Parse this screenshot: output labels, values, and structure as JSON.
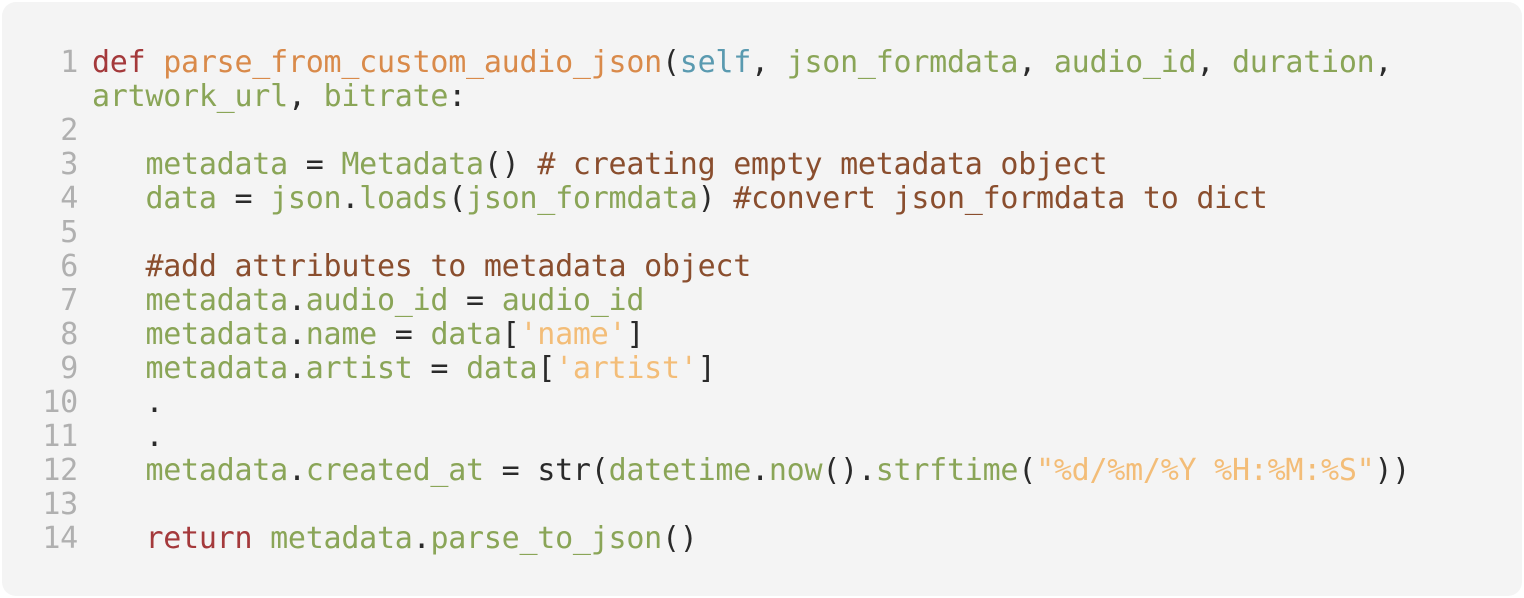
{
  "code": {
    "lines": [
      {
        "n": "1",
        "indent": "",
        "wrap": true,
        "tokens": [
          {
            "t": "def",
            "c": "kw"
          },
          {
            "t": " ",
            "c": "p"
          },
          {
            "t": "parse_from_custom_audio_json",
            "c": "fn"
          },
          {
            "t": "(",
            "c": "p"
          },
          {
            "t": "self",
            "c": "self"
          },
          {
            "t": ", ",
            "c": "p"
          },
          {
            "t": "json_formdata",
            "c": "var"
          },
          {
            "t": ", ",
            "c": "p"
          },
          {
            "t": "audio_id",
            "c": "var"
          },
          {
            "t": ", ",
            "c": "p"
          },
          {
            "t": "duration",
            "c": "var"
          },
          {
            "t": ",",
            "c": "p"
          }
        ]
      },
      {
        "n": "",
        "indent": "",
        "tokens": [
          {
            "t": "artwork_url",
            "c": "var"
          },
          {
            "t": ", ",
            "c": "p"
          },
          {
            "t": "bitrate",
            "c": "var"
          },
          {
            "t": ":",
            "c": "p"
          }
        ]
      },
      {
        "n": "2",
        "indent": "",
        "tokens": []
      },
      {
        "n": "3",
        "indent": "   ",
        "tokens": [
          {
            "t": "metadata",
            "c": "var"
          },
          {
            "t": " = ",
            "c": "p"
          },
          {
            "t": "Metadata",
            "c": "var"
          },
          {
            "t": "() ",
            "c": "p"
          },
          {
            "t": "# creating empty metadata object",
            "c": "com"
          }
        ]
      },
      {
        "n": "4",
        "indent": "   ",
        "tokens": [
          {
            "t": "data",
            "c": "var"
          },
          {
            "t": " = ",
            "c": "p"
          },
          {
            "t": "json",
            "c": "var"
          },
          {
            "t": ".",
            "c": "p"
          },
          {
            "t": "loads",
            "c": "var"
          },
          {
            "t": "(",
            "c": "p"
          },
          {
            "t": "json_formdata",
            "c": "var"
          },
          {
            "t": ") ",
            "c": "p"
          },
          {
            "t": "#convert json_formdata to dict",
            "c": "com"
          }
        ]
      },
      {
        "n": "5",
        "indent": "",
        "tokens": []
      },
      {
        "n": "6",
        "indent": "   ",
        "tokens": [
          {
            "t": "#add attributes to metadata object",
            "c": "com"
          }
        ]
      },
      {
        "n": "7",
        "indent": "   ",
        "tokens": [
          {
            "t": "metadata",
            "c": "var"
          },
          {
            "t": ".",
            "c": "p"
          },
          {
            "t": "audio_id",
            "c": "var"
          },
          {
            "t": " = ",
            "c": "p"
          },
          {
            "t": "audio_id",
            "c": "var"
          }
        ]
      },
      {
        "n": "8",
        "indent": "   ",
        "tokens": [
          {
            "t": "metadata",
            "c": "var"
          },
          {
            "t": ".",
            "c": "p"
          },
          {
            "t": "name",
            "c": "var"
          },
          {
            "t": " = ",
            "c": "p"
          },
          {
            "t": "data",
            "c": "var"
          },
          {
            "t": "[",
            "c": "p"
          },
          {
            "t": "'name'",
            "c": "str"
          },
          {
            "t": "]",
            "c": "p"
          }
        ]
      },
      {
        "n": "9",
        "indent": "   ",
        "tokens": [
          {
            "t": "metadata",
            "c": "var"
          },
          {
            "t": ".",
            "c": "p"
          },
          {
            "t": "artist",
            "c": "var"
          },
          {
            "t": " = ",
            "c": "p"
          },
          {
            "t": "data",
            "c": "var"
          },
          {
            "t": "[",
            "c": "p"
          },
          {
            "t": "'artist'",
            "c": "str"
          },
          {
            "t": "]",
            "c": "p"
          }
        ]
      },
      {
        "n": "10",
        "indent": "   ",
        "tokens": [
          {
            "t": ".",
            "c": "p"
          }
        ]
      },
      {
        "n": "11",
        "indent": "   ",
        "tokens": [
          {
            "t": ".",
            "c": "p"
          }
        ]
      },
      {
        "n": "12",
        "indent": "   ",
        "tokens": [
          {
            "t": "metadata",
            "c": "var"
          },
          {
            "t": ".",
            "c": "p"
          },
          {
            "t": "created_at",
            "c": "var"
          },
          {
            "t": " = ",
            "c": "p"
          },
          {
            "t": "str(",
            "c": "p"
          },
          {
            "t": "datetime",
            "c": "var"
          },
          {
            "t": ".",
            "c": "p"
          },
          {
            "t": "now",
            "c": "var"
          },
          {
            "t": "().",
            "c": "p"
          },
          {
            "t": "strftime",
            "c": "var"
          },
          {
            "t": "(",
            "c": "p"
          },
          {
            "t": "\"%d/%m/%Y %H:%M:%S\"",
            "c": "str"
          },
          {
            "t": "))",
            "c": "p"
          }
        ]
      },
      {
        "n": "13",
        "indent": "",
        "tokens": []
      },
      {
        "n": "14",
        "indent": "   ",
        "tokens": [
          {
            "t": "return",
            "c": "kw"
          },
          {
            "t": " ",
            "c": "p"
          },
          {
            "t": "metadata",
            "c": "var"
          },
          {
            "t": ".",
            "c": "p"
          },
          {
            "t": "parse_to_json",
            "c": "var"
          },
          {
            "t": "()",
            "c": "p"
          }
        ]
      }
    ]
  },
  "colors": {
    "background": "#f4f4f4",
    "keyword": "#a4393b",
    "function_name": "#d98a4a",
    "self": "#5a9ab0",
    "identifier": "#8aa557",
    "string": "#f3bd78",
    "comment": "#8a4e2e",
    "punctuation": "#2a2a2a",
    "line_number": "#b0b0b0"
  }
}
